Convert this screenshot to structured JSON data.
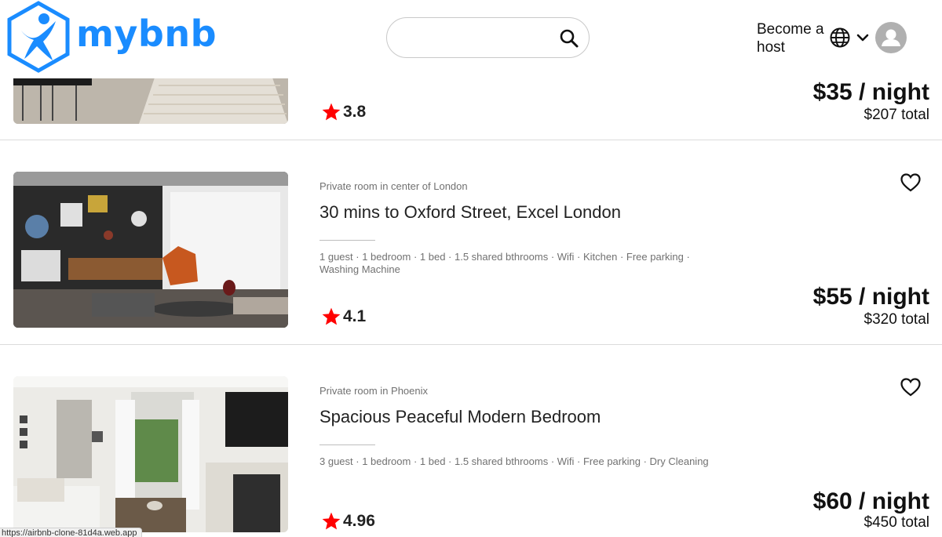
{
  "header": {
    "brand": "mybnb",
    "search": {
      "value": "",
      "placeholder": ""
    },
    "host_label": "Become a host",
    "icons": {
      "search": "search-icon",
      "globe": "globe-icon",
      "chevron": "chevron-down-icon",
      "avatar": "user-avatar-icon"
    },
    "brand_color": "#1a8cff"
  },
  "listings": [
    {
      "rating": "3.8",
      "price": "$35 / night",
      "total": "$207 total"
    },
    {
      "subtitle": "Private room in center of London",
      "title": "30 mins to Oxford Street, Excel London",
      "amenities": "1 guest · 1 bedroom · 1 bed · 1.5 shared bthrooms · Wifi · Kitchen · Free parking · Washing Machine",
      "rating": "4.1",
      "price": "$55 / night",
      "total": "$320 total"
    },
    {
      "subtitle": "Private room in Phoenix",
      "title": "Spacious Peaceful Modern Bedroom",
      "amenities": "3 guest · 1 bedroom · 1 bed · 1.5 shared bthrooms · Wifi · Free parking · Dry Cleaning",
      "rating": "4.96",
      "price": "$60 / night",
      "total": "$450 total"
    }
  ],
  "status_url": "https://airbnb-clone-81d4a.web.app",
  "colors": {
    "star": "#ff0000",
    "divider": "#dcdcdc",
    "muted_text": "#717171"
  }
}
